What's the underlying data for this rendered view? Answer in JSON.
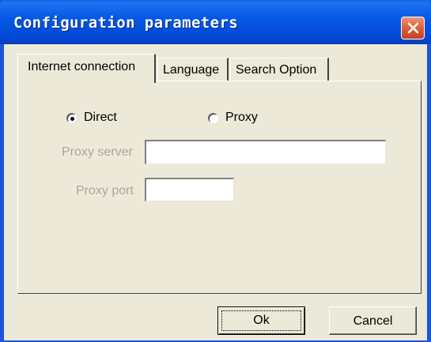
{
  "window": {
    "title": "Configuration parameters",
    "title_color": "#ffffff",
    "titlebar_color": "#0559e6",
    "body_color": "#ece9d8",
    "close_icon": "close-x-icon"
  },
  "tabs": [
    {
      "label": "Internet connection",
      "active": true
    },
    {
      "label": "Language",
      "active": false
    },
    {
      "label": "Search Option",
      "active": false
    }
  ],
  "connection": {
    "options": [
      {
        "label": "Direct",
        "selected": true
      },
      {
        "label": "Proxy",
        "selected": false
      }
    ],
    "proxy_server": {
      "label": "Proxy server",
      "value": "",
      "enabled": false
    },
    "proxy_port": {
      "label": "Proxy port",
      "value": "",
      "enabled": false
    }
  },
  "buttons": {
    "ok": "Ok",
    "cancel": "Cancel"
  }
}
